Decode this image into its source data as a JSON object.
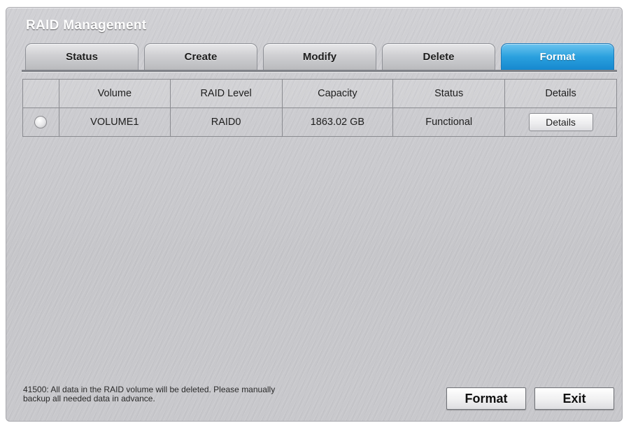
{
  "title": "RAID Management",
  "tabs": [
    {
      "label": "Status",
      "active": false
    },
    {
      "label": "Create",
      "active": false
    },
    {
      "label": "Modify",
      "active": false
    },
    {
      "label": "Delete",
      "active": false
    },
    {
      "label": "Format",
      "active": true
    }
  ],
  "table": {
    "headers": [
      "",
      "Volume",
      "RAID Level",
      "Capacity",
      "Status",
      "Details"
    ],
    "rows": [
      {
        "selected": false,
        "volume": "VOLUME1",
        "raid_level": "RAID0",
        "capacity": "1863.02 GB",
        "status": "Functional",
        "details_label": "Details"
      }
    ]
  },
  "message": {
    "line1": "41500: All data in the RAID volume will be deleted.  Please manually",
    "line2": "backup all needed data in advance."
  },
  "actions": {
    "format_label": "Format",
    "exit_label": "Exit"
  },
  "colors": {
    "active_tab": "#2aa0de",
    "panel": "#c9c9cd"
  }
}
